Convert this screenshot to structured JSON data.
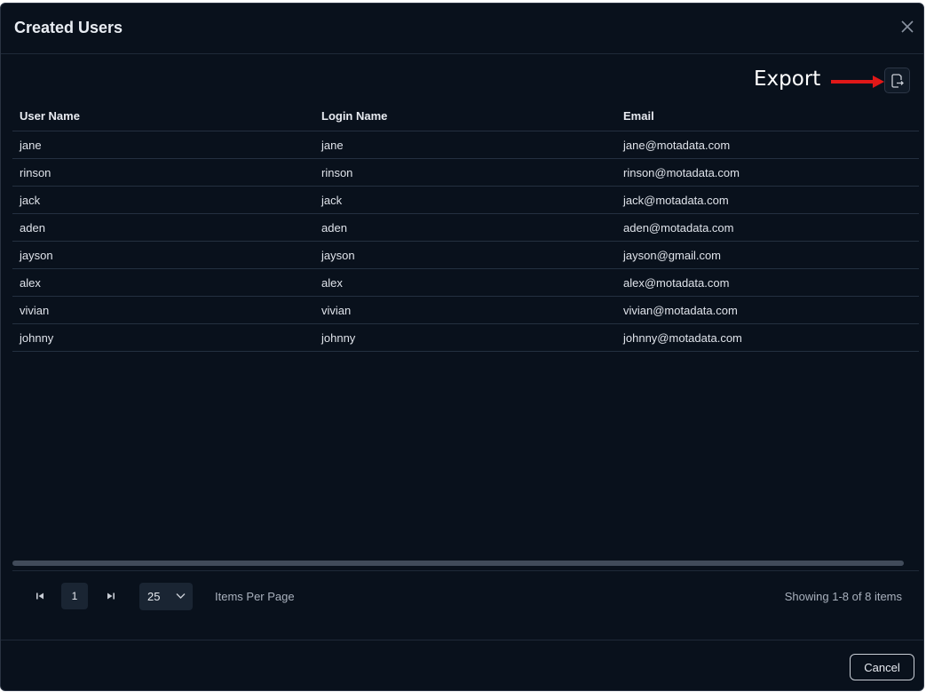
{
  "dialog": {
    "title": "Created Users",
    "annotation": "Export",
    "columns": [
      "User Name",
      "Login Name",
      "Email"
    ],
    "rows": [
      [
        "jane",
        "jane",
        "jane@motadata.com"
      ],
      [
        "rinson",
        "rinson",
        "rinson@motadata.com"
      ],
      [
        "jack",
        "jack",
        "jack@motadata.com"
      ],
      [
        "aden",
        "aden",
        "aden@motadata.com"
      ],
      [
        "jayson",
        "jayson",
        "jayson@gmail.com"
      ],
      [
        "alex",
        "alex",
        "alex@motadata.com"
      ],
      [
        "vivian",
        "vivian",
        "vivian@motadata.com"
      ],
      [
        "johnny",
        "johnny",
        "johnny@motadata.com"
      ]
    ]
  },
  "pagination": {
    "current_page": "1",
    "per_page": "25",
    "per_page_label": "Items Per Page",
    "showing": "Showing 1-8 of 8 items"
  },
  "footer": {
    "cancel_label": "Cancel"
  },
  "colors": {
    "background": "#09111c",
    "annotation_arrow": "#e01818",
    "border": "#243040"
  },
  "icons": [
    "close-icon",
    "export-icon",
    "first-page-icon",
    "last-page-icon",
    "chevron-down-icon"
  ]
}
